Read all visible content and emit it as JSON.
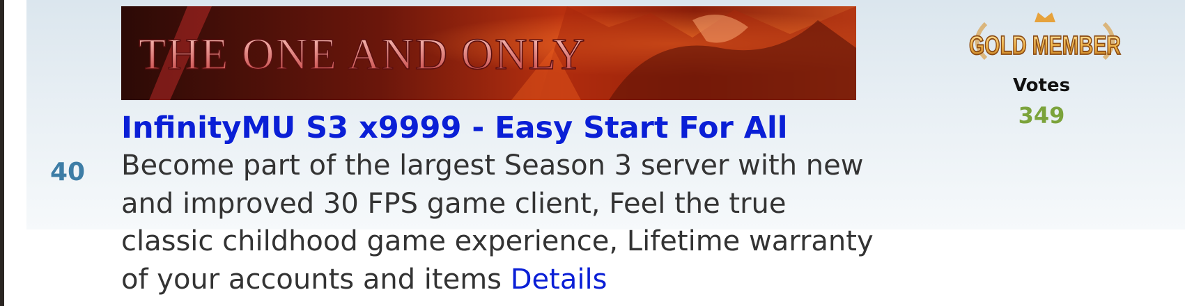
{
  "listing": {
    "rank": "40",
    "banner_text": "THE ONE AND ONLY",
    "title": "InfinityMU S3 x9999 - Easy Start For All",
    "description": "Become part of the largest Season 3 server with new and improved 30 FPS game client, Feel the true classic childhood game experience, Lifetime warranty of your accounts and items",
    "details_link": "Details",
    "membership_badge": "GOLD MEMBER",
    "votes_label": "Votes",
    "votes_count": "349"
  },
  "colors": {
    "title_link": "#0a1fd6",
    "rank": "#3d7da6",
    "votes_count": "#7ba33b",
    "badge_gold": "#f0b44a"
  }
}
